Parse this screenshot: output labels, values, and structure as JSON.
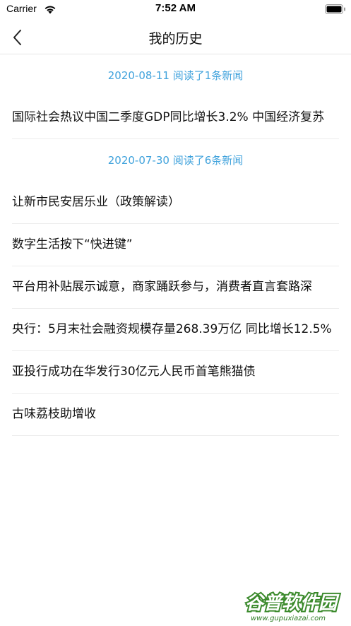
{
  "status_bar": {
    "carrier": "Carrier",
    "time": "7:52 AM"
  },
  "nav": {
    "title": "我的历史"
  },
  "groups": [
    {
      "header": "2020-08-11 阅读了1条新闻",
      "items": [
        "国际社会热议中国二季度GDP同比增长3.2% 中国经济复苏"
      ]
    },
    {
      "header": "2020-07-30 阅读了6条新闻",
      "items": [
        "让新市民安居乐业（政策解读）",
        "数字生活按下“快进键”",
        "平台用补贴展示诚意，商家踊跃参与，消费者直言套路深",
        "央行：5月末社会融资规模存量268.39万亿 同比增长12.5%",
        "亚投行成功在华发行30亿元人民币首笔熊猫债",
        "古味荔枝助增收"
      ]
    }
  ],
  "watermark": {
    "brand": "谷普软件园",
    "url": "www.gupuxiazai.com"
  }
}
